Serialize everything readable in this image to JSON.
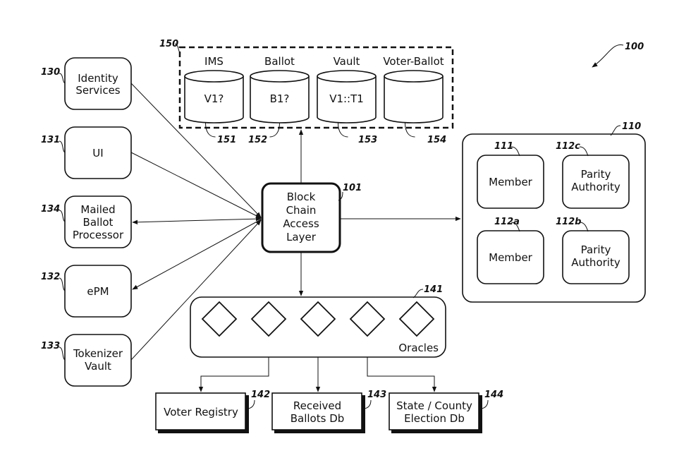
{
  "figure_ref": "100",
  "clients": [
    {
      "ref": "130",
      "label1": "Identity",
      "label2": "Services"
    },
    {
      "ref": "131",
      "label1": "UI",
      "label2": ""
    },
    {
      "ref": "134",
      "label1": "Mailed",
      "label2": "Ballot",
      "label3": "Processor"
    },
    {
      "ref": "132",
      "label1": "ePM",
      "label2": ""
    },
    {
      "ref": "133",
      "label1": "Tokenizer",
      "label2": "Vault"
    }
  ],
  "storage": {
    "ref": "150",
    "stores": [
      {
        "title": "IMS",
        "content": "V1?",
        "ref": "151"
      },
      {
        "title": "Ballot",
        "content": "B1?",
        "ref": "152"
      },
      {
        "title": "Vault",
        "content": "V1::T1",
        "ref": "153"
      },
      {
        "title": "Voter-Ballot",
        "content": "",
        "ref": "154"
      }
    ]
  },
  "access_layer": {
    "ref": "101",
    "line1": "Block",
    "line2": "Chain",
    "line3": "Access",
    "line4": "Layer"
  },
  "network": {
    "ref": "110",
    "nodes": [
      {
        "ref": "111",
        "line1": "Member",
        "line2": ""
      },
      {
        "ref": "112c",
        "line1": "Parity",
        "line2": "Authority"
      },
      {
        "ref": "112a",
        "line1": "Member",
        "line2": ""
      },
      {
        "ref": "112b",
        "line1": "Parity",
        "line2": "Authority"
      }
    ]
  },
  "oracles": {
    "ref": "141",
    "label": "Oracles",
    "count": 5
  },
  "external_dbs": [
    {
      "ref": "142",
      "line1": "Voter Registry",
      "line2": ""
    },
    {
      "ref": "143",
      "line1": "Received",
      "line2": "Ballots Db"
    },
    {
      "ref": "144",
      "line1": "State / County",
      "line2": "Election Db"
    }
  ]
}
